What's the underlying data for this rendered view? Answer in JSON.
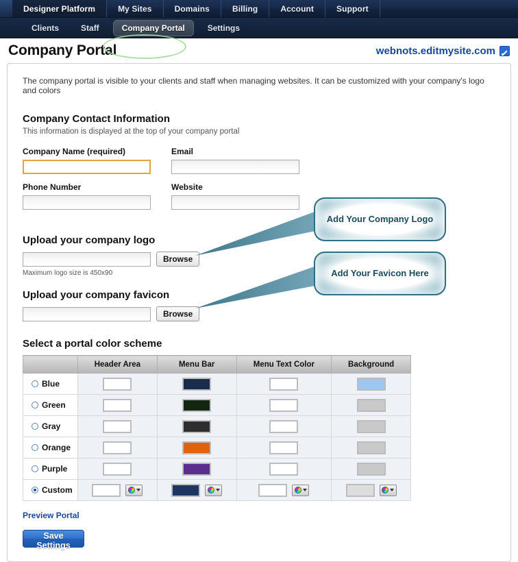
{
  "topnav": {
    "items": [
      {
        "label": "Designer Platform",
        "active": true
      },
      {
        "label": "My Sites",
        "active": false
      },
      {
        "label": "Domains",
        "active": false
      },
      {
        "label": "Billing",
        "active": false
      },
      {
        "label": "Account",
        "active": false
      },
      {
        "label": "Support",
        "active": false
      }
    ]
  },
  "subnav": {
    "items": [
      {
        "label": "Clients",
        "selected": false
      },
      {
        "label": "Staff",
        "selected": false
      },
      {
        "label": "Company Portal",
        "selected": true
      },
      {
        "label": "Settings",
        "selected": false
      }
    ]
  },
  "header": {
    "title": "Company Portal",
    "site_url": "webnots.editmysite.com",
    "edit_icon": "pencil-edit-icon"
  },
  "intro": "The company portal is visible to your clients and staff when managing websites. It can be customized with your company's logo and colors",
  "contact": {
    "heading": "Company Contact Information",
    "subtext": "This information is displayed at the top of your company portal",
    "fields": [
      {
        "label": "Company Name (required)",
        "value": "",
        "placeholder": "",
        "focused": true
      },
      {
        "label": "Email",
        "value": "",
        "placeholder": "",
        "focused": false
      },
      {
        "label": "Phone Number",
        "value": "",
        "placeholder": "",
        "focused": false
      },
      {
        "label": "Website",
        "value": "",
        "placeholder": "",
        "focused": false
      }
    ]
  },
  "logo_upload": {
    "heading": "Upload your company logo",
    "value": "",
    "browse_label": "Browse",
    "hint": "Maximum logo size is 450x90"
  },
  "favicon_upload": {
    "heading": "Upload your company favicon",
    "value": "",
    "browse_label": "Browse"
  },
  "callouts": [
    {
      "text": "Add Your Company Logo"
    },
    {
      "text": "Add Your Favicon Here"
    }
  ],
  "color_scheme": {
    "heading": "Select a portal color scheme",
    "columns": [
      "",
      "Header Area",
      "Menu Bar",
      "Menu Text Color",
      "Background"
    ],
    "rows": [
      {
        "name": "Blue",
        "selected": false,
        "header_area": "#ffffff",
        "menu_bar": "#1a2c4e",
        "menu_text": "#ffffff",
        "background": "#9dc7f0",
        "has_picker": false
      },
      {
        "name": "Green",
        "selected": false,
        "header_area": "#ffffff",
        "menu_bar": "#13260f",
        "menu_text": "#ffffff",
        "background": "#c9c9c9",
        "has_picker": false
      },
      {
        "name": "Gray",
        "selected": false,
        "header_area": "#ffffff",
        "menu_bar": "#2e2e2e",
        "menu_text": "#ffffff",
        "background": "#c9c9c9",
        "has_picker": false
      },
      {
        "name": "Orange",
        "selected": false,
        "header_area": "#ffffff",
        "menu_bar": "#e0620d",
        "menu_text": "#ffffff",
        "background": "#c9c9c9",
        "has_picker": false
      },
      {
        "name": "Purple",
        "selected": false,
        "header_area": "#ffffff",
        "menu_bar": "#5a2d8f",
        "menu_text": "#ffffff",
        "background": "#c9c9c9",
        "has_picker": false
      },
      {
        "name": "Custom",
        "selected": true,
        "header_area": "#ffffff",
        "menu_bar": "#1d3560",
        "menu_text": "#ffffff",
        "background": "#dddddd",
        "has_picker": true
      }
    ],
    "picker_icon": "color-wheel-icon"
  },
  "footer": {
    "preview_label": "Preview Portal",
    "save_label": "Save Settings"
  },
  "colors": {
    "link": "#14489c",
    "focus_border": "#e8a33d",
    "callout_border": "#2f6f86",
    "save_button": "#2462bb"
  }
}
